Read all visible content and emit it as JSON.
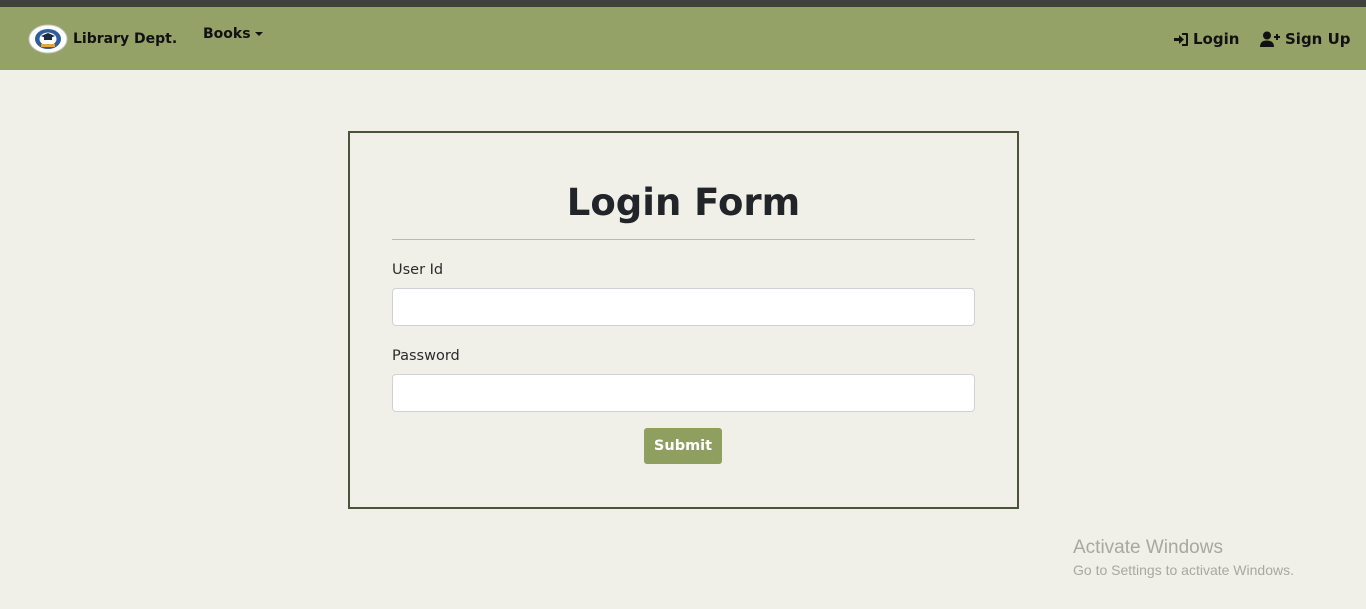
{
  "navbar": {
    "brand": "Library Dept.",
    "menu": {
      "books_label": "Books"
    },
    "right": {
      "login_label": "Login",
      "signup_label": "Sign Up"
    },
    "colors": {
      "background": "#94a268",
      "top_strip": "#3f423b",
      "text": "#111111"
    }
  },
  "form": {
    "title": "Login Form",
    "user_id": {
      "label": "User Id",
      "value": "",
      "placeholder": ""
    },
    "password": {
      "label": "Password",
      "value": "",
      "placeholder": ""
    },
    "submit_label": "Submit",
    "colors": {
      "card_border": "#48553b",
      "submit_bg": "#8f9f5f",
      "submit_text": "#ffffff"
    }
  },
  "os_watermark": {
    "title": "Activate Windows",
    "subtitle": "Go to Settings to activate Windows."
  },
  "page": {
    "background": "#f0f0e8"
  },
  "icons": {
    "logo": "library-logo",
    "books_dropdown": "caret-down-icon",
    "login": "sign-in-icon",
    "signup": "user-plus-icon"
  }
}
